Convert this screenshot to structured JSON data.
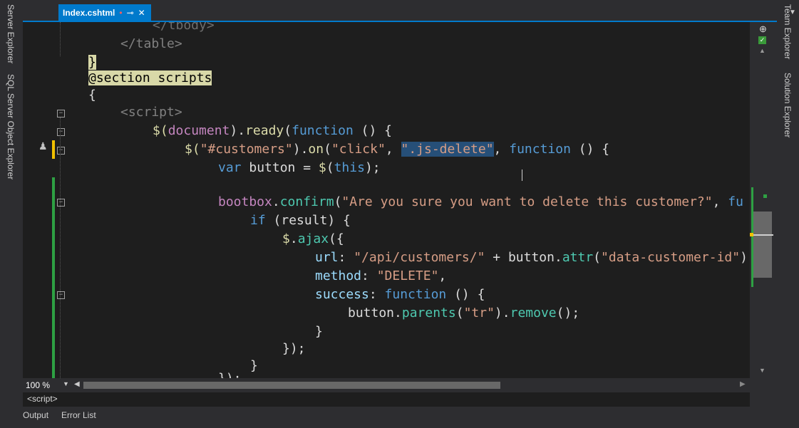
{
  "left_rail": {
    "tabs": [
      "Server Explorer",
      "SQL Server Object Explorer"
    ]
  },
  "right_rail": {
    "tabs": [
      "Team Explorer",
      "Solution Explorer"
    ]
  },
  "tab": {
    "title": "Index.cshtml",
    "modified": "•",
    "pin": "⊸",
    "close": "✕"
  },
  "code": {
    "l1": "</tbody>",
    "l2": "</table>",
    "l3": "}",
    "l4": "@section scripts",
    "l5": "{",
    "l6": "<script>",
    "l7a": "$(",
    "l7b": "document",
    "l7c": ").",
    "l7d": "ready",
    "l7e": "(",
    "l7f": "function",
    "l7g": " () {",
    "l8a": "$(",
    "l8b": "\"#customers\"",
    "l8c": ").",
    "l8d": "on",
    "l8e": "(",
    "l8f": "\"click\"",
    "l8g": ", ",
    "l8h": "\".js-delete\"",
    "l8i": ", ",
    "l8j": "function",
    "l8k": " () {",
    "l9a": "var",
    "l9b": " button = ",
    "l9c": "$",
    "l9d": "(",
    "l9e": "this",
    "l9f": ");",
    "l10a": "bootbox",
    "l10b": ".",
    "l10c": "confirm",
    "l10d": "(",
    "l10e": "\"Are you sure you want to delete this customer?\"",
    "l10f": ", ",
    "l10g": "fu",
    "l11a": "if",
    "l11b": " (result) {",
    "l12a": "$",
    "l12b": ".",
    "l12c": "ajax",
    "l12d": "({",
    "l13a": "url",
    "l13b": ": ",
    "l13c": "\"/api/customers/\"",
    "l13d": " + button.",
    "l13e": "attr",
    "l13f": "(",
    "l13g": "\"data-customer-id\"",
    "l13h": ")",
    "l14a": "method",
    "l14b": ": ",
    "l14c": "\"DELETE\"",
    "l14d": ",",
    "l15a": "success",
    "l15b": ": ",
    "l15c": "function",
    "l15d": " () {",
    "l16a": "button.",
    "l16b": "parents",
    "l16c": "(",
    "l16d": "\"tr\"",
    "l16e": ").",
    "l16f": "remove",
    "l16g": "();",
    "l17": "}",
    "l18": "});",
    "l19": "}",
    "l20": "});"
  },
  "status": {
    "zoom": "100 %",
    "breadcrumb": "<script>"
  },
  "bottom_tabs": [
    "Output",
    "Error List"
  ]
}
